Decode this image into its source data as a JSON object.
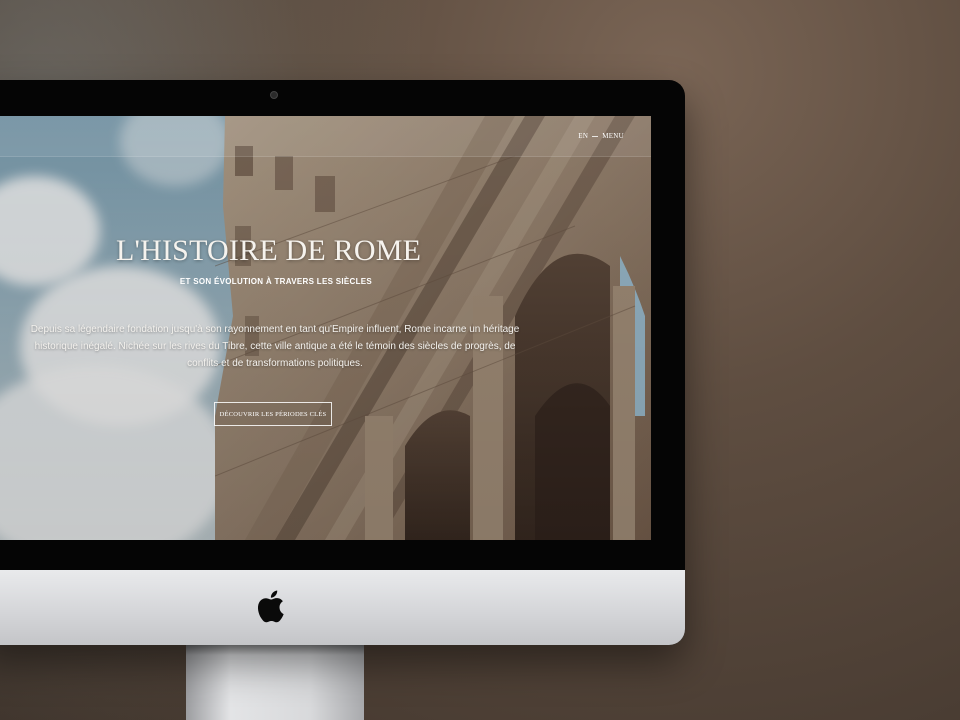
{
  "nav": {
    "lang": "EN",
    "menu": "MENU"
  },
  "hero": {
    "title": "L'HISTOIRE DE ROME",
    "subtitle": "ET SON ÉVOLUTION À TRAVERS LES SIÈCLES",
    "paragraph": "Depuis sa légendaire fondation jusqu'à son rayonnement en tant qu'Empire influent, Rome incarne un héritage historique inégalé. Nichée sur les rives du Tibre, cette ville antique a été le témoin des siècles de progrès, de conflits et de transformations politiques.",
    "cta": "DÉCOUVRIR LES PÉRIODES CLÉS"
  },
  "device": {
    "logo": "apple-icon",
    "colors": {
      "bezel": "#050505",
      "chin": "#d5d6d9",
      "background": "#5f4e41"
    }
  }
}
